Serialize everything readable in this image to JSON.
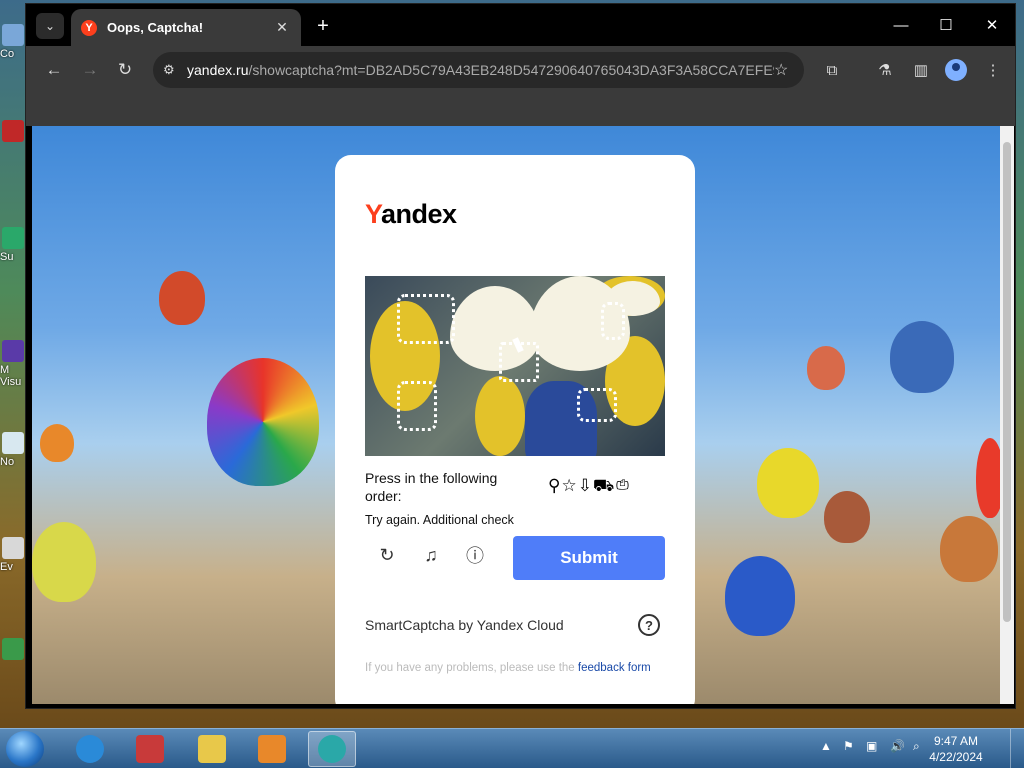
{
  "desktop": {
    "icons": [
      {
        "label": "Co"
      },
      {
        "label": "Su"
      },
      {
        "label": "M"
      },
      {
        "label": "Visu"
      },
      {
        "label": "No"
      },
      {
        "label": "Ev"
      }
    ]
  },
  "browser": {
    "tab": {
      "title": "Oops, Captcha!",
      "close": "✕"
    },
    "new_tab": "+",
    "window_controls": {
      "minimize": "—",
      "maximize": "☐",
      "close": "✕"
    },
    "nav": {
      "back": "←",
      "forward": "→",
      "reload": "↻"
    },
    "address": {
      "domain": "yandex.ru",
      "path": "/showcaptcha?mt=DB2AD5C79A43EB248D547290640765043DA3F3A58CCA7EFE9..."
    }
  },
  "captcha": {
    "logo_first": "Y",
    "logo_rest": "andex",
    "prompt": "Press in the following order:",
    "order_icons": "⚲☆⇩⛟⎙",
    "warning": "Try again. Additional check",
    "submit_label": "Submit",
    "branding": "SmartCaptcha by Yandex Cloud",
    "help_icon": "?",
    "footer_text": "If you have any problems, please use the ",
    "footer_link": "feedback form"
  },
  "taskbar": {
    "time": "9:47 AM",
    "date": "4/22/2024"
  },
  "colors": {
    "submit": "#4f7df9",
    "yandex_red": "#fc3f1d",
    "link": "#1a4aa8"
  }
}
